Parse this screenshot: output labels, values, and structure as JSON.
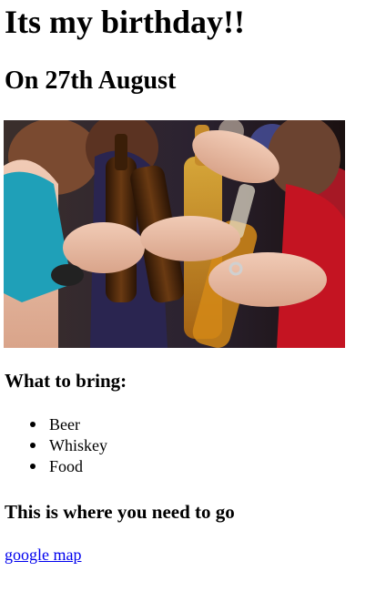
{
  "heading": "Its my birthday!!",
  "date_heading": "On 27th August",
  "photo": {
    "description_icon": "party-photo-icon"
  },
  "bring": {
    "heading": "What to bring:",
    "items": [
      "Beer",
      "Whiskey",
      "Food"
    ]
  },
  "location": {
    "heading": "This is where you need to go",
    "link_label": "google map"
  },
  "colors": {
    "link": "#0000ee",
    "text": "#000000",
    "background": "#ffffff"
  }
}
